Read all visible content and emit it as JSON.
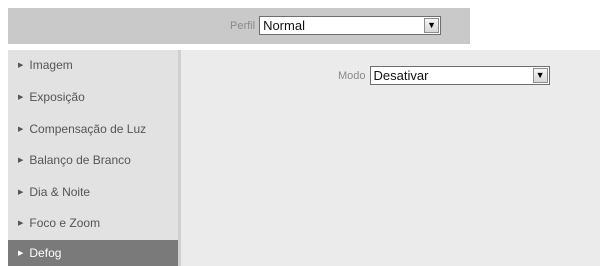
{
  "header": {
    "profile_label": "Perfil",
    "profile_value": "Normal"
  },
  "sidebar": {
    "items": [
      {
        "label": "Imagem",
        "active": false
      },
      {
        "label": "Exposição",
        "active": false
      },
      {
        "label": "Compensação de Luz",
        "active": false
      },
      {
        "label": "Balanço de Branco",
        "active": false
      },
      {
        "label": "Dia & Noite",
        "active": false
      },
      {
        "label": "Foco e Zoom",
        "active": false
      },
      {
        "label": "Defog",
        "active": true
      }
    ]
  },
  "main": {
    "mode_label": "Modo",
    "mode_value": "Desativar"
  },
  "icons": {
    "nav_arrow": "caret-right-icon",
    "dropdown": "dropdown-arrow-icon"
  },
  "colors": {
    "active_item_bg": "#7a7a7a",
    "header_bg": "#c9c9c9",
    "panel_bg": "#ebebeb"
  }
}
